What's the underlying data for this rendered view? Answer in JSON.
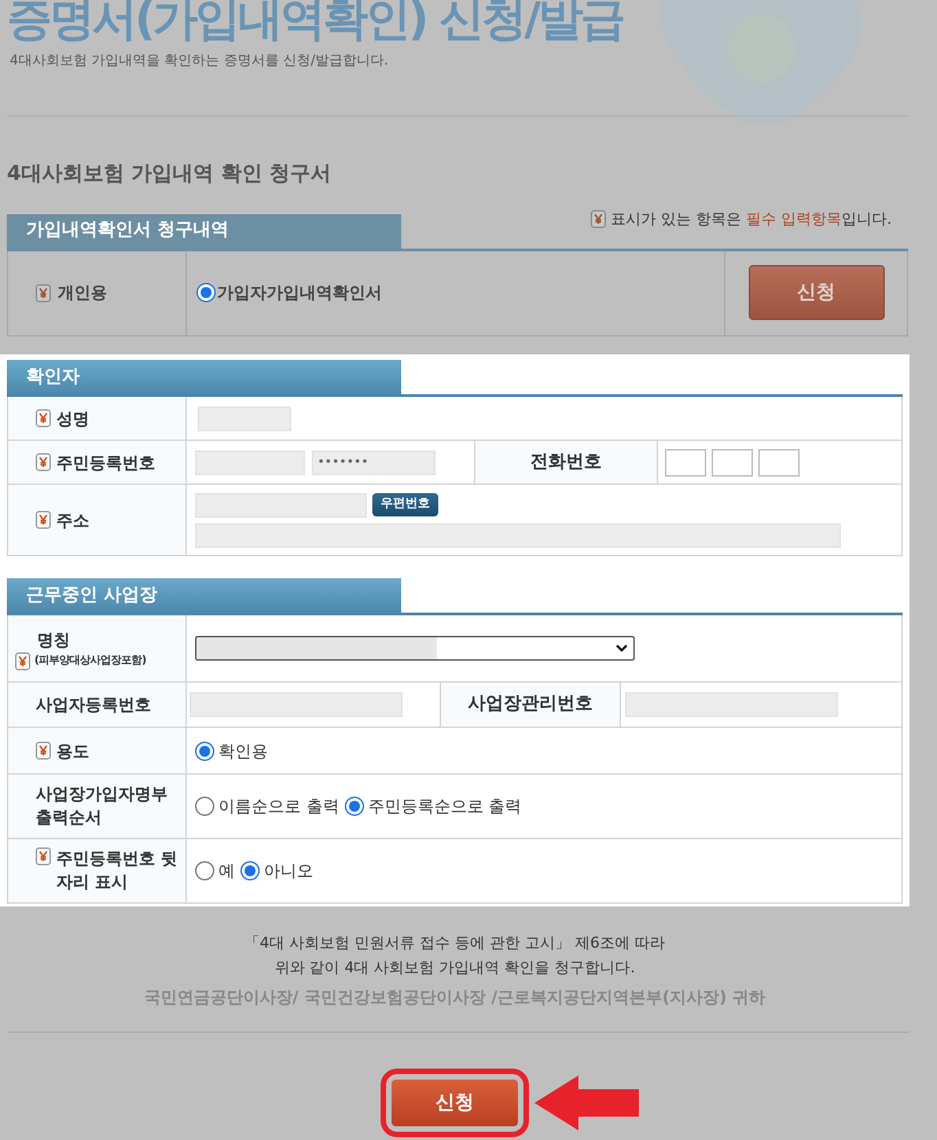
{
  "page": {
    "title": "증명서(가입내역확인) 신청/발급",
    "subtitle": "4대사회보험 가입내역을 확인하는 증명서를 신청/발급합니다."
  },
  "form_title": "4대사회보험 가입내역 확인 청구서",
  "required_note": {
    "before": "표시가 있는 항목은 ",
    "highlight": "필수 입력항목",
    "after": "입니다."
  },
  "request": {
    "tab": "가입내역확인서 청구내역",
    "label": "개인용",
    "required": true,
    "options": [
      {
        "label": "가입자가입내역확인서",
        "selected": true
      }
    ],
    "button": "신청"
  },
  "applicant": {
    "tab": "확인자",
    "rows": [
      {
        "label": "성명",
        "required": true
      },
      {
        "label": "주민등록번호",
        "required": true,
        "masked_value": "•••••••",
        "side_label": "전화번호"
      },
      {
        "label": "주소",
        "required": true,
        "button": "우편번호"
      }
    ]
  },
  "workplace": {
    "tab": "근무중인 사업장",
    "rows": [
      {
        "kind": "select",
        "label": "명칭",
        "sublabel": "(피부양대상사업장포함)",
        "required": true
      },
      {
        "kind": "pair",
        "label": "사업자등록번호",
        "required": false,
        "side_label": "사업장관리번호"
      },
      {
        "kind": "radio",
        "label": "용도",
        "required": true,
        "options": [
          {
            "label": "확인용",
            "selected": true
          }
        ]
      },
      {
        "kind": "radio",
        "label": "사업장가입자명부 출력순서",
        "required": false,
        "options": [
          {
            "label": "이름순으로 출력",
            "selected": false
          },
          {
            "label": "주민등록순으로 출력",
            "selected": true
          }
        ]
      },
      {
        "kind": "radio",
        "label": "주민등록번호 뒷자리 표시",
        "required": true,
        "options": [
          {
            "label": "예",
            "selected": false
          },
          {
            "label": "아니오",
            "selected": true
          }
        ]
      }
    ]
  },
  "footer": {
    "lines": [
      "「4대 사회보험 민원서류 접수 등에 관한 고시」 제6조에 따라",
      "위와 같이 4대 사회보험 가입내역 확인을 청구합니다."
    ],
    "addressee": "국민연금공단이사장/ 국민건강보험공단이사장 /근로복지공단지역본부(지사장) 귀하",
    "submit": "신청",
    "highlighted": true
  }
}
